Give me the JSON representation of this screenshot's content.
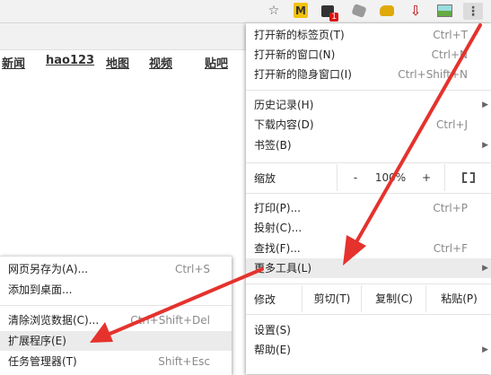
{
  "toolbar": {
    "icons": [
      "star-icon",
      "extension-m-icon",
      "extension-badge-icon",
      "extension-puzzle-icon",
      "extension-dog-icon",
      "extension-download-icon",
      "extension-image-icon",
      "menu-dots-icon"
    ],
    "ext_m_label": "M",
    "ext_badge_count": "1",
    "menu_glyph": "⋮"
  },
  "page": {
    "nav": [
      "新闻",
      "hao123",
      "地图",
      "视频",
      "贴吧"
    ]
  },
  "main_menu": {
    "items": [
      {
        "label": "打开新的标签页(T)",
        "shortcut": "Ctrl+T"
      },
      {
        "label": "打开新的窗口(N)",
        "shortcut": "Ctrl+N"
      },
      {
        "label": "打开新的隐身窗口(I)",
        "shortcut": "Ctrl+Shift+N"
      },
      {
        "label": "历史记录(H)",
        "shortcut": ""
      },
      {
        "label": "下载内容(D)",
        "shortcut": "Ctrl+J"
      },
      {
        "label": "书签(B)",
        "shortcut": ""
      },
      {
        "label": "打印(P)...",
        "shortcut": "Ctrl+P"
      },
      {
        "label": "投射(C)...",
        "shortcut": ""
      },
      {
        "label": "查找(F)...",
        "shortcut": "Ctrl+F"
      },
      {
        "label": "更多工具(L)",
        "shortcut": ""
      },
      {
        "label": "设置(S)",
        "shortcut": ""
      },
      {
        "label": "帮助(E)",
        "shortcut": ""
      }
    ],
    "zoom": {
      "label": "缩放",
      "minus": "-",
      "value": "100%",
      "plus": "+"
    },
    "edit": {
      "label": "修改",
      "cut": "剪切(T)",
      "copy": "复制(C)",
      "paste": "粘贴(P)"
    }
  },
  "sub_menu": {
    "items": [
      {
        "label": "网页另存为(A)...",
        "shortcut": "Ctrl+S"
      },
      {
        "label": "添加到桌面...",
        "shortcut": ""
      },
      {
        "label": "清除浏览数据(C)...",
        "shortcut": "Ctrl+Shift+Del"
      },
      {
        "label": "扩展程序(E)",
        "shortcut": ""
      },
      {
        "label": "任务管理器(T)",
        "shortcut": "Shift+Esc"
      }
    ]
  },
  "colors": {
    "arrow": "#e5322d",
    "highlight": "#ebebeb"
  }
}
